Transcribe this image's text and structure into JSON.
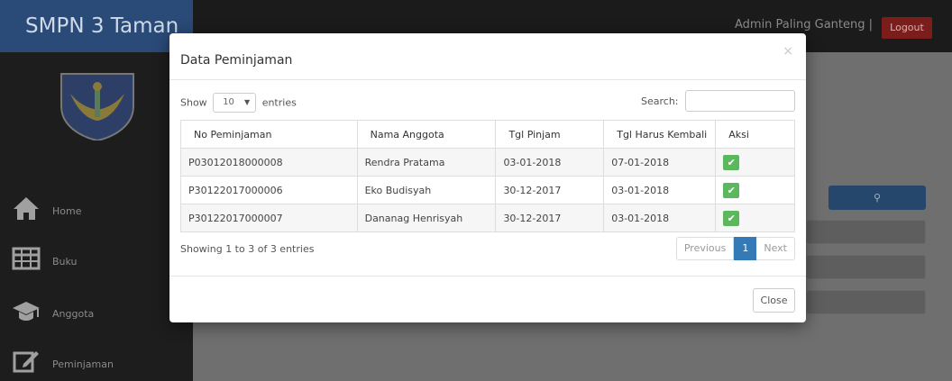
{
  "app": {
    "brand": "SMPN 3 Taman",
    "user_label": "Admin Paling Ganteng |",
    "logout_label": "Logout"
  },
  "sidebar": {
    "items": [
      {
        "label": "Home",
        "icon": "home-icon"
      },
      {
        "label": "Buku",
        "icon": "table-icon"
      },
      {
        "label": "Anggota",
        "icon": "graduation-cap-icon"
      },
      {
        "label": "Peminjaman",
        "icon": "edit-icon"
      }
    ]
  },
  "modal": {
    "title": "Data Peminjaman",
    "close_x": "×",
    "show_label": "Show",
    "entries_label": "entries",
    "page_length": "10",
    "search_label": "Search:",
    "search_value": "",
    "columns": [
      "No Peminjaman",
      "Nama Anggota",
      "Tgl Pinjam",
      "Tgl Harus Kembali",
      "Aksi"
    ],
    "rows": [
      {
        "no": "P03012018000008",
        "nama": "Rendra Pratama",
        "tgl_pinjam": "03-01-2018",
        "tgl_kembali": "07-01-2018"
      },
      {
        "no": "P30122017000006",
        "nama": "Eko Budisyah",
        "tgl_pinjam": "30-12-2017",
        "tgl_kembali": "03-01-2018"
      },
      {
        "no": "P30122017000007",
        "nama": "Dananag Henrisyah",
        "tgl_pinjam": "30-12-2017",
        "tgl_kembali": "03-01-2018"
      }
    ],
    "info": "Showing 1 to 3 of 3 entries",
    "pager": {
      "previous": "Previous",
      "current": "1",
      "next": "Next"
    },
    "close_label": "Close"
  },
  "colors": {
    "brand_bg": "#2a4a77",
    "logout_bg": "#7b1d1b",
    "primary": "#337ab7",
    "success": "#5cb85c"
  }
}
